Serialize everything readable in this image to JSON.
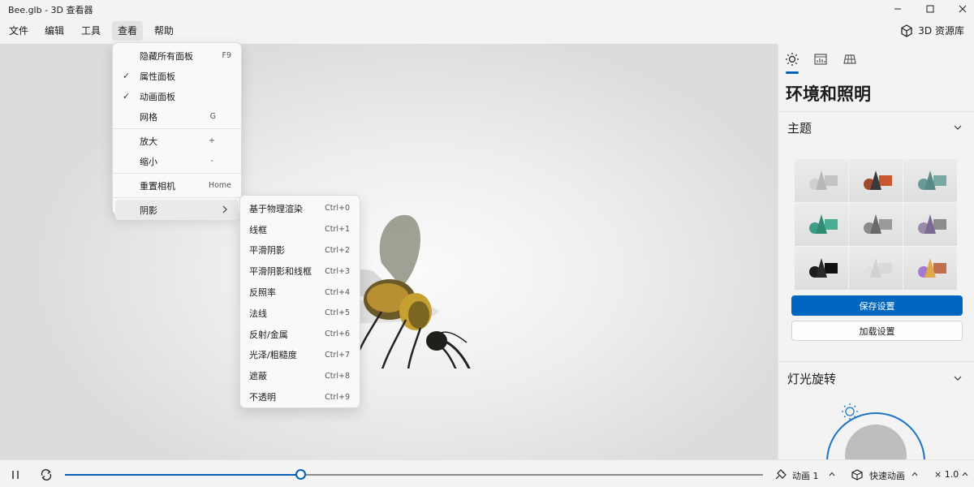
{
  "window": {
    "title": "Bee.glb - 3D 查看器",
    "minimize_icon": "minimize-icon",
    "maximize_icon": "maximize-icon",
    "close_icon": "close-icon"
  },
  "menubar": {
    "items": [
      "文件",
      "编辑",
      "工具",
      "查看",
      "帮助"
    ],
    "active": "查看",
    "library_label": "3D 资源库",
    "library_icon": "cube-icon"
  },
  "view_menu": {
    "items": [
      {
        "label": "隐藏所有面板",
        "shortcut": "F9",
        "checked": false
      },
      {
        "label": "属性面板",
        "shortcut": "",
        "checked": true
      },
      {
        "label": "动画面板",
        "shortcut": "",
        "checked": true
      },
      {
        "label": "网格",
        "shortcut": "G",
        "checked": false
      },
      {
        "label": "放大",
        "shortcut": "+",
        "checked": false
      },
      {
        "label": "缩小",
        "shortcut": "-",
        "checked": false
      },
      {
        "label": "重置相机",
        "shortcut": "Home",
        "checked": false
      },
      {
        "label": "阴影",
        "shortcut": "",
        "checked": false,
        "has_submenu": true
      }
    ],
    "check_glyph": "✓"
  },
  "shading_submenu": {
    "items": [
      {
        "label": "基于物理渲染",
        "shortcut": "Ctrl+0"
      },
      {
        "label": "线框",
        "shortcut": "Ctrl+1"
      },
      {
        "label": "平滑阴影",
        "shortcut": "Ctrl+2"
      },
      {
        "label": "平滑阴影和线框",
        "shortcut": "Ctrl+3"
      },
      {
        "label": "反照率",
        "shortcut": "Ctrl+4"
      },
      {
        "label": "法线",
        "shortcut": "Ctrl+5"
      },
      {
        "label": "反射/金属",
        "shortcut": "Ctrl+6"
      },
      {
        "label": "光泽/粗糙度",
        "shortcut": "Ctrl+7"
      },
      {
        "label": "遮蔽",
        "shortcut": "Ctrl+8"
      },
      {
        "label": "不透明",
        "shortcut": "Ctrl+9"
      }
    ]
  },
  "panel": {
    "tabs": [
      "sun-icon",
      "stats-icon",
      "grid-icon"
    ],
    "title": "环境和照明",
    "theme_section": "主题",
    "themes": [
      {
        "name": "gray",
        "sphere": "#d0d0d0",
        "cone": "#b8b8b8",
        "box": "#c4c4c4"
      },
      {
        "name": "orange",
        "sphere": "#a04a30",
        "cone": "#3a3a3a",
        "box": "#c8582e"
      },
      {
        "name": "teal",
        "sphere": "#6a9a94",
        "cone": "#5a8a86",
        "box": "#7aa8a2"
      },
      {
        "name": "green",
        "sphere": "#3c9e84",
        "cone": "#2f8c74",
        "box": "#48ad92"
      },
      {
        "name": "darkgray",
        "sphere": "#8a8a8a",
        "cone": "#6a6a6a",
        "box": "#9a9a9a"
      },
      {
        "name": "purple",
        "sphere": "#9a8aaa",
        "cone": "#7a6a94",
        "box": "#8c8c8c"
      },
      {
        "name": "black",
        "sphere": "#1c1c1c",
        "cone": "#2a2a2a",
        "box": "#101010"
      },
      {
        "name": "white",
        "sphere": "#e0e0e0",
        "cone": "#d2d2d2",
        "box": "#dadada"
      },
      {
        "name": "rainbow",
        "sphere": "#a57bd1",
        "cone": "#e0a84a",
        "box": "#c0704a"
      }
    ],
    "save_label": "保存设置",
    "load_label": "加载设置",
    "light_section": "灯光旋转",
    "light_icon": "sun-icon"
  },
  "playback": {
    "pause_icon": "pause-icon",
    "loop_icon": "loop-icon",
    "progress": 0.337,
    "animation_icon": "animation-icon",
    "animation_label": "动画 1",
    "quick_icon": "quick-animation-icon",
    "quick_label": "快速动画",
    "speed_label": "× 1.0"
  },
  "colors": {
    "accent": "#005fb8",
    "primary_button": "#0067c0"
  }
}
